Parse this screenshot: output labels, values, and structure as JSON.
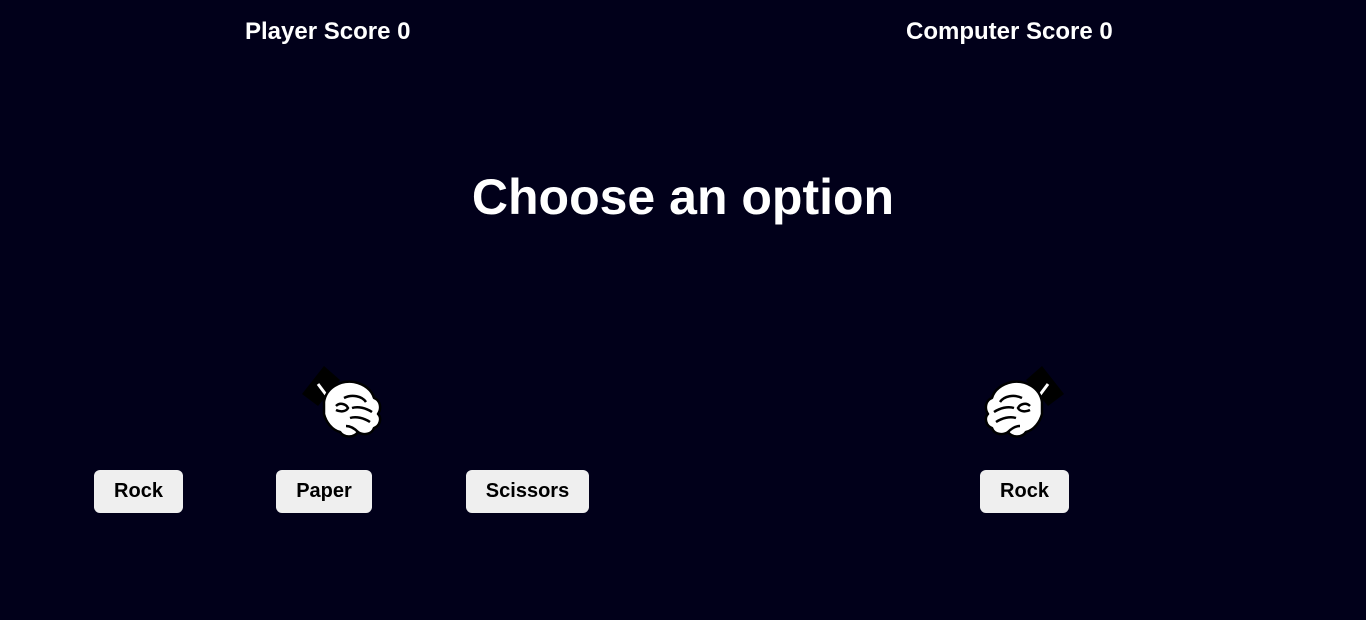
{
  "scores": {
    "player_label": "Player Score 0",
    "computer_label": "Computer Score 0"
  },
  "heading": "Choose an option",
  "player": {
    "hand_icon": "rock-fist-icon",
    "options": {
      "rock": "Rock",
      "paper": "Paper",
      "scissors": "Scissors"
    }
  },
  "computer": {
    "hand_icon": "rock-fist-icon",
    "choice": "Rock"
  },
  "colors": {
    "background": "#01001a",
    "text": "#ffffff",
    "button_bg": "#efefef"
  }
}
